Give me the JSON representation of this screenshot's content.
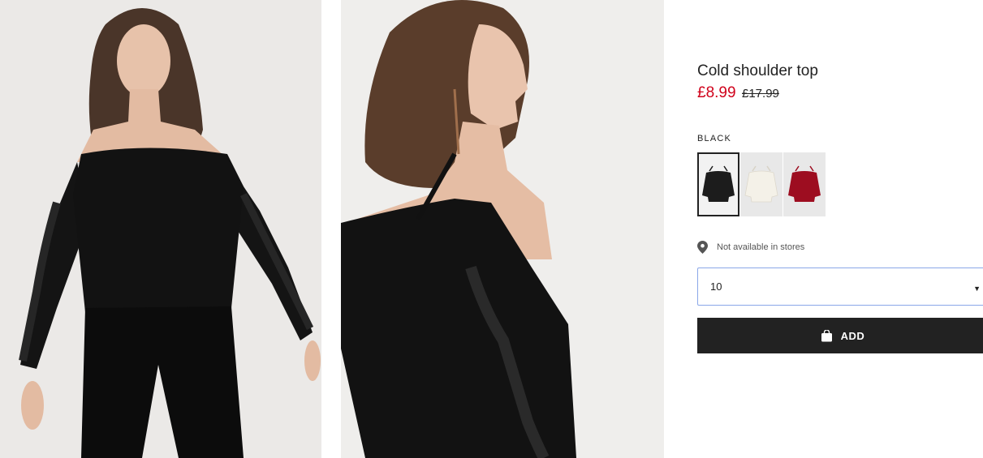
{
  "product": {
    "title": "Cold shoulder top",
    "price_sale": "£8.99",
    "price_original": "£17.99",
    "selected_color": "BLACK",
    "swatches": [
      {
        "color_name": "black",
        "hex": "#1c1c1c"
      },
      {
        "color_name": "white",
        "hex": "#f4f1e8"
      },
      {
        "color_name": "red",
        "hex": "#9d0d20"
      }
    ],
    "store_availability": "Not available in stores",
    "size_value": "10",
    "add_label": "ADD"
  },
  "colors": {
    "sale": "#d0021b",
    "button": "#222222",
    "select_border": "#8aa7e8"
  },
  "icons": {
    "location": "location-pin-icon",
    "bag": "shopping-bag-icon",
    "caret": "chevron-down-icon"
  }
}
